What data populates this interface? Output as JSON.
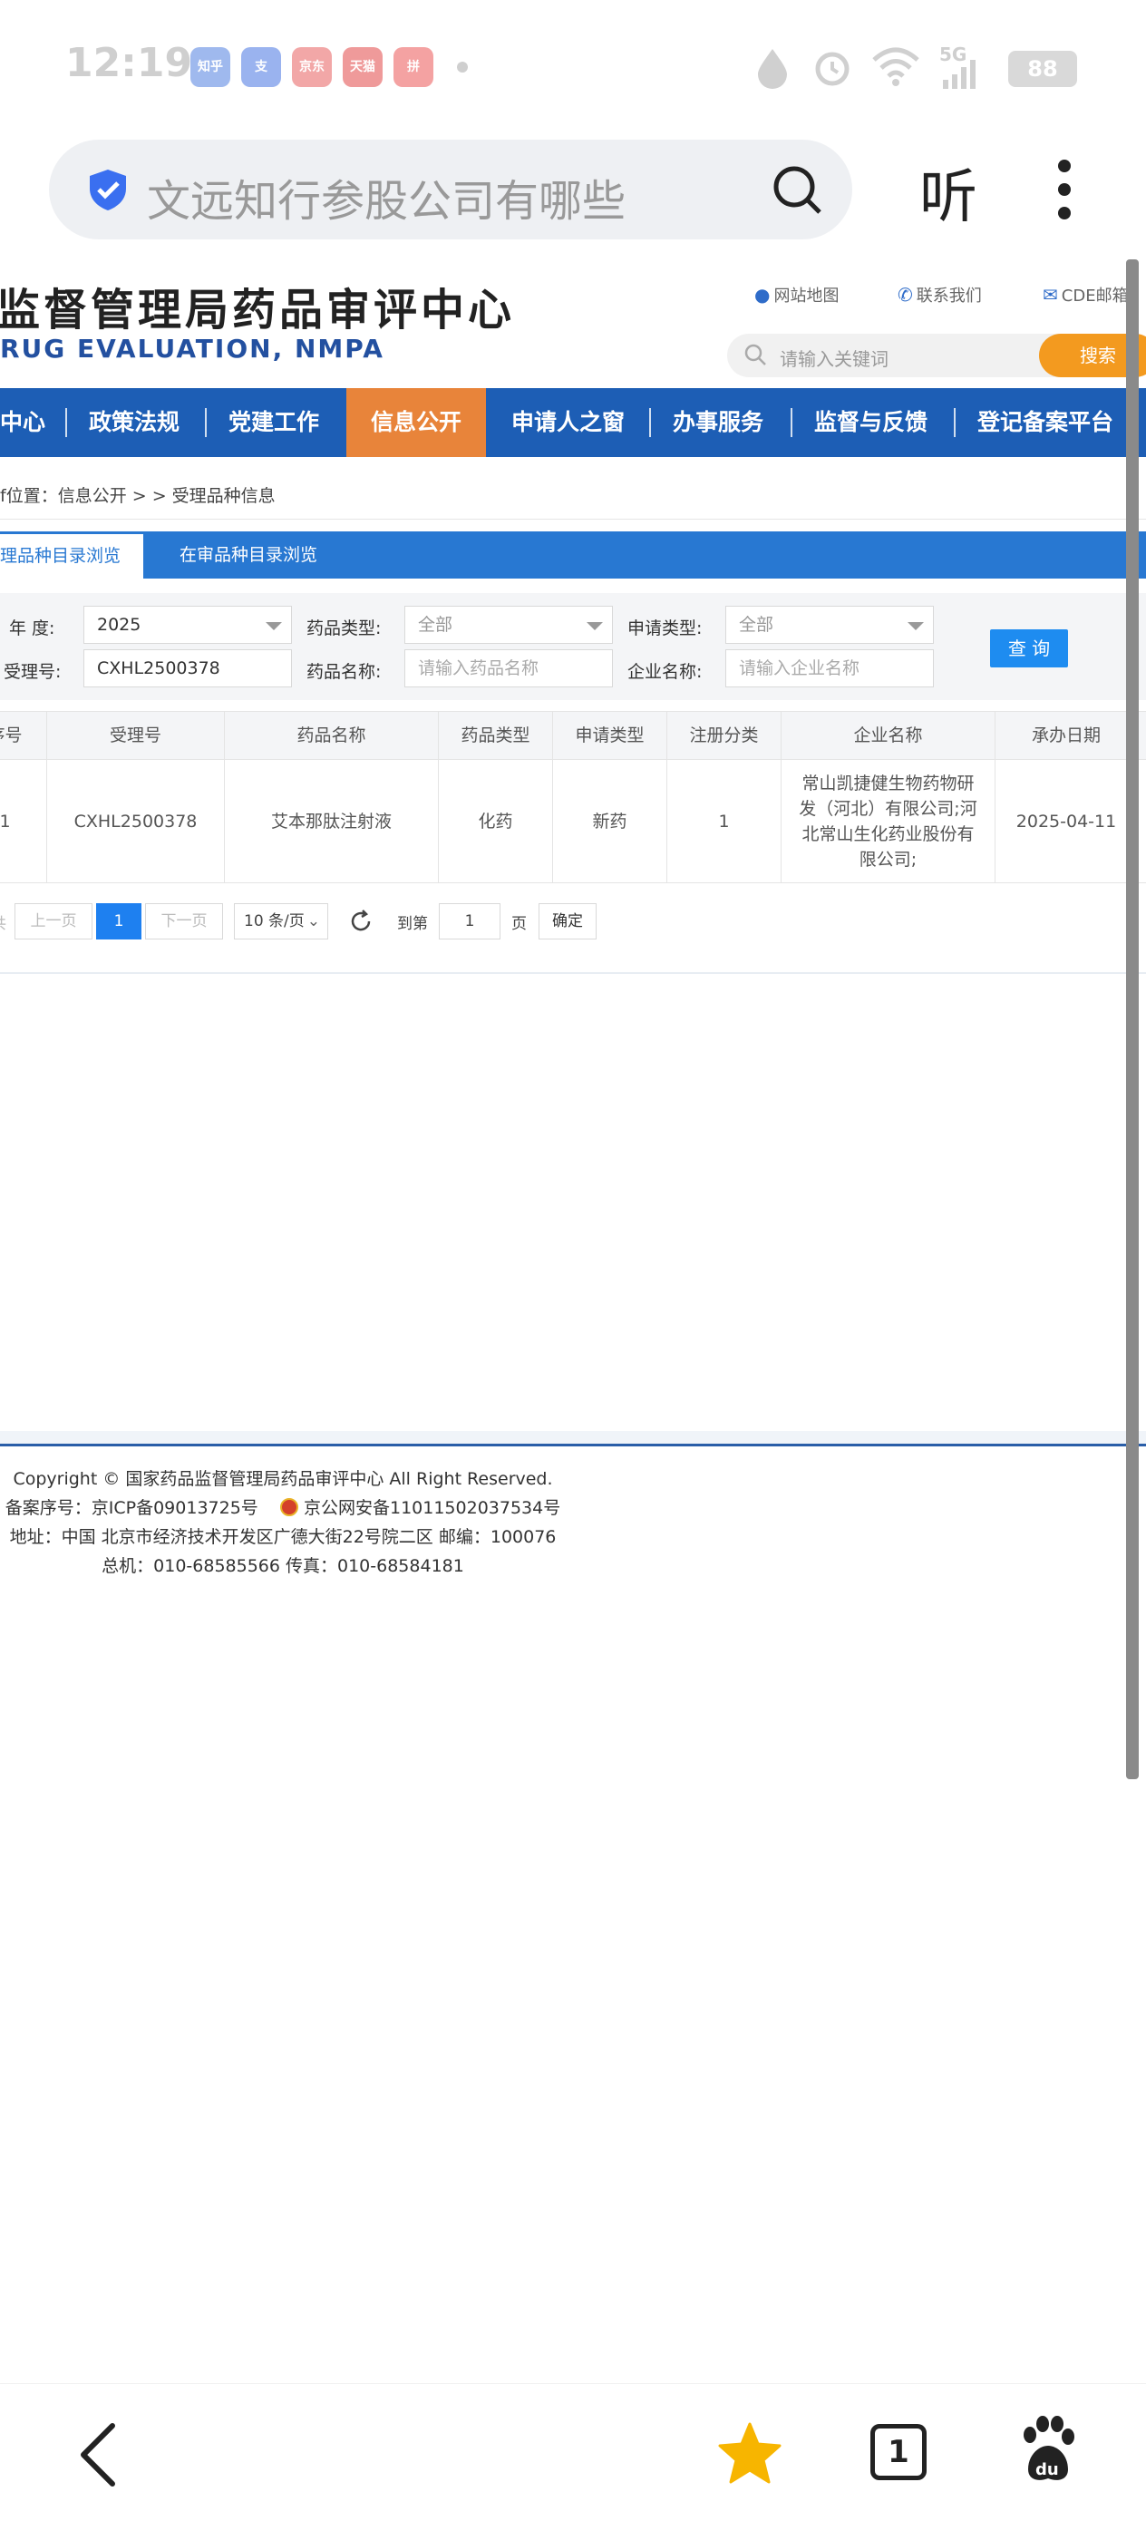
{
  "statusbar": {
    "time": "12:19",
    "apps": [
      "知乎",
      "支",
      "京东",
      "天猫",
      "拼"
    ],
    "network": "5G",
    "battery": "88"
  },
  "browser": {
    "search_text": "文远知行参股公司有哪些",
    "listen_label": "听"
  },
  "site": {
    "title": "监督管理局药品审评中心",
    "subtitle": "RUG EVALUATION, NMPA",
    "links": [
      "网站地图",
      "联系我们",
      "CDE邮箱"
    ],
    "keyword_placeholder": "请输入关键词",
    "search_button": "搜索"
  },
  "nav": {
    "items": [
      "中心",
      "政策法规",
      "党建工作",
      "信息公开",
      "申请人之窗",
      "办事服务",
      "监督与反馈",
      "登记备案平台"
    ],
    "active": "信息公开"
  },
  "breadcrumb": "f位置：信息公开 > > 受理品种信息",
  "tabs": {
    "active": "理品种目录浏览",
    "inactive": "在审品种目录浏览"
  },
  "filters": {
    "year_label": "年    度:",
    "year_value": "2025",
    "drug_type_label": "药品类型:",
    "drug_type_value": "全部",
    "apply_type_label": "申请类型:",
    "apply_type_value": "全部",
    "accept_no_label": "受理号:",
    "accept_no_value": "CXHL2500378",
    "drug_name_label": "药品名称:",
    "drug_name_placeholder": "请输入药品名称",
    "company_label": "企业名称:",
    "company_placeholder": "请输入企业名称",
    "query_button": "查 询"
  },
  "table": {
    "headers": [
      "序号",
      "受理号",
      "药品名称",
      "药品类型",
      "申请类型",
      "注册分类",
      "企业名称",
      "承办日期"
    ],
    "rows": [
      {
        "index": "1",
        "accept_no": "CXHL2500378",
        "drug_name": "艾本那肽注射液",
        "drug_type": "化药",
        "apply_type": "新药",
        "reg_class": "1",
        "company": "常山凯捷健生物药物研发（河北）有限公司;河北常山生化药业股份有限公司;",
        "date": "2025-04-11"
      }
    ]
  },
  "pager": {
    "prefix": "共",
    "prev": "上一页",
    "current": "1",
    "next": "下一页",
    "per_page": "10 条/页",
    "goto_label": "到第",
    "goto_value": "1",
    "page_suffix": "页",
    "confirm": "确定"
  },
  "footer": {
    "copyright": "Copyright © 国家药品监督管理局药品审评中心   All Right Reserved.",
    "icp": "备案序号：京ICP备09013725号",
    "police": "京公网安备11011502037534号",
    "address": "地址：中国 北京市经济技术开发区广德大街22号院二区      邮编：100076",
    "phone": "总机：010-68585566      传真：010-68584181"
  },
  "bottombar": {
    "tab_count": "1"
  },
  "colors": {
    "nav_blue": "#1d5eb5",
    "active_orange": "#e8843a",
    "search_orange": "#f39a1f",
    "tab_blue": "#2878d2",
    "query_blue": "#1e8cf0"
  }
}
